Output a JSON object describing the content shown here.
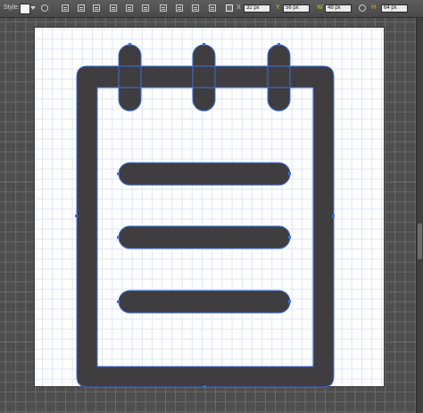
{
  "toolbar": {
    "style_label": "Style:",
    "x_value": "32 px",
    "y_value": "56 px",
    "w_value": "48 px",
    "h_value": "64 px"
  },
  "colors": {
    "icon_fill": "#3f3d40",
    "selection": "#3c6fd8",
    "artboard": "#ffffff",
    "pasteboard": "#4e4e4e"
  },
  "canvas": {
    "artwork_name": "notepad-icon"
  }
}
